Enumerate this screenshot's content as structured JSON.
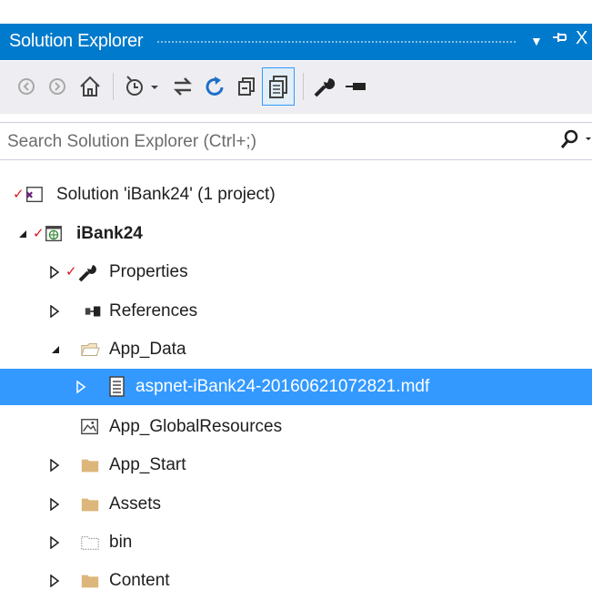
{
  "panel": {
    "title": "Solution Explorer",
    "controls": {
      "dropdown": "▼",
      "pin": "⊣",
      "close": "X"
    }
  },
  "toolbar": {
    "buttons": [
      "back-icon",
      "forward-icon",
      "home-icon",
      "pending-changes-icon",
      "sync-icon",
      "refresh-icon",
      "collapse-all-icon",
      "show-all-files-icon",
      "properties-icon",
      "preview-icon"
    ],
    "active": "show-all-files-icon"
  },
  "search": {
    "placeholder": "Search Solution Explorer (Ctrl+;)",
    "value": ""
  },
  "tree": {
    "items": [
      {
        "label": "Solution 'iBank24' (1 project)",
        "icon": "solution-icon",
        "level": 0
      },
      {
        "label": "iBank24",
        "icon": "web-project-icon",
        "level": 1,
        "expanded": true,
        "bold": true
      },
      {
        "label": "Properties",
        "icon": "wrench-icon",
        "level": 2,
        "expanded": false
      },
      {
        "label": "References",
        "icon": "references-icon",
        "level": 2,
        "expanded": false
      },
      {
        "label": "App_Data",
        "icon": "open-folder-icon",
        "level": 2,
        "expanded": true
      },
      {
        "label": "aspnet-iBank24-20160621072821.mdf",
        "icon": "database-file-icon",
        "level": 3,
        "expanded": false,
        "selected": true
      },
      {
        "label": "App_GlobalResources",
        "icon": "resources-icon",
        "level": 2
      },
      {
        "label": "App_Start",
        "icon": "folder-icon",
        "level": 2,
        "expanded": false
      },
      {
        "label": "Assets",
        "icon": "folder-icon",
        "level": 2,
        "expanded": false
      },
      {
        "label": "bin",
        "icon": "dashed-folder-icon",
        "level": 2,
        "expanded": false
      },
      {
        "label": "Content",
        "icon": "folder-icon",
        "level": 2,
        "expanded": false
      }
    ]
  },
  "colors": {
    "accent": "#007acc",
    "selection": "#3399ff",
    "folder": "#dcb67a",
    "checkmark": "#d71920"
  }
}
